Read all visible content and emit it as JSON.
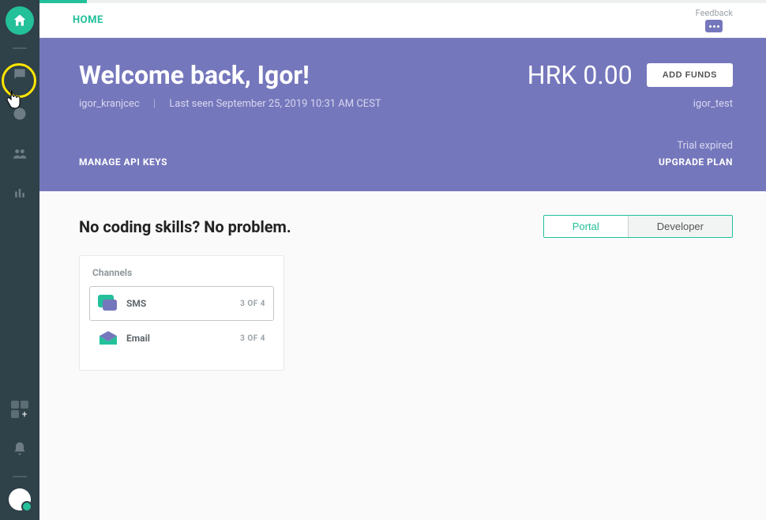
{
  "breadcrumb": {
    "home": "HOME"
  },
  "feedback": {
    "label": "Feedback"
  },
  "hero": {
    "welcome": "Welcome back, Igor!",
    "username": "igor_kranjcec",
    "lastSeen": "Last seen September 25, 2019 10:31 AM CEST",
    "balance": "HRK 0.00",
    "addFunds": "ADD FUNDS",
    "account": "igor_test",
    "trialStatus": "Trial expired",
    "manageKeys": "MANAGE API KEYS",
    "upgrade": "UPGRADE PLAN"
  },
  "body": {
    "heading": "No coding skills? No problem.",
    "toggle": {
      "portal": "Portal",
      "developer": "Developer"
    },
    "channelsTitle": "Channels",
    "channels": [
      {
        "name": "SMS",
        "count": "3 OF 4"
      },
      {
        "name": "Email",
        "count": "3 OF 4"
      }
    ]
  }
}
